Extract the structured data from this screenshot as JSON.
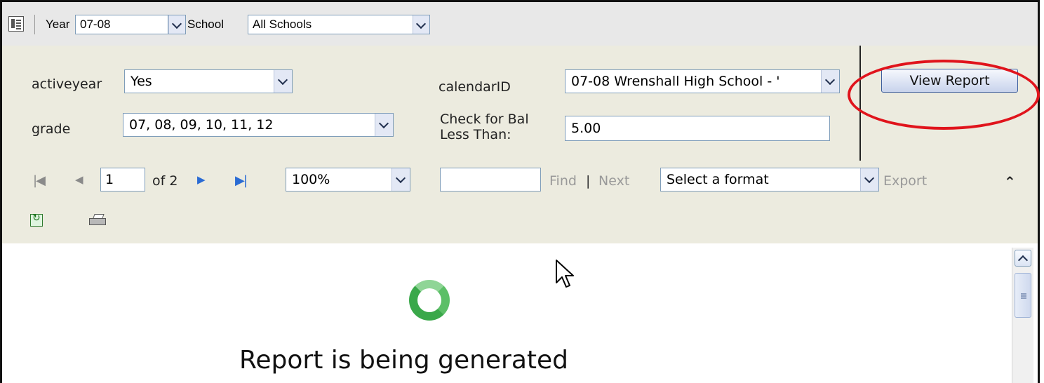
{
  "topbar": {
    "year_label": "Year",
    "year_value": "07-08",
    "school_label": "School",
    "school_value": "All Schools"
  },
  "params": {
    "activeyear_label": "activeyear",
    "activeyear_value": "Yes",
    "grade_label": "grade",
    "grade_value": "07, 08, 09, 10, 11, 12",
    "calendar_label": "calendarID",
    "calendar_value": "07-08 Wrenshall High School - '",
    "balance_label_line1": "Check for Bal",
    "balance_label_line2": "Less Than:",
    "balance_value": "5.00",
    "view_report_label": "View Report"
  },
  "toolbar": {
    "page_value": "1",
    "page_of": "of 2",
    "zoom_value": "100%",
    "find_label": "Find",
    "separator": "|",
    "next_label": "Next",
    "format_value": "Select a format",
    "export_label": "Export"
  },
  "report": {
    "status_text": "Report is being generated"
  },
  "colors": {
    "highlight_circle": "#e0141c",
    "param_background": "#ecebdf",
    "spinner_green": "#3aa84a"
  }
}
